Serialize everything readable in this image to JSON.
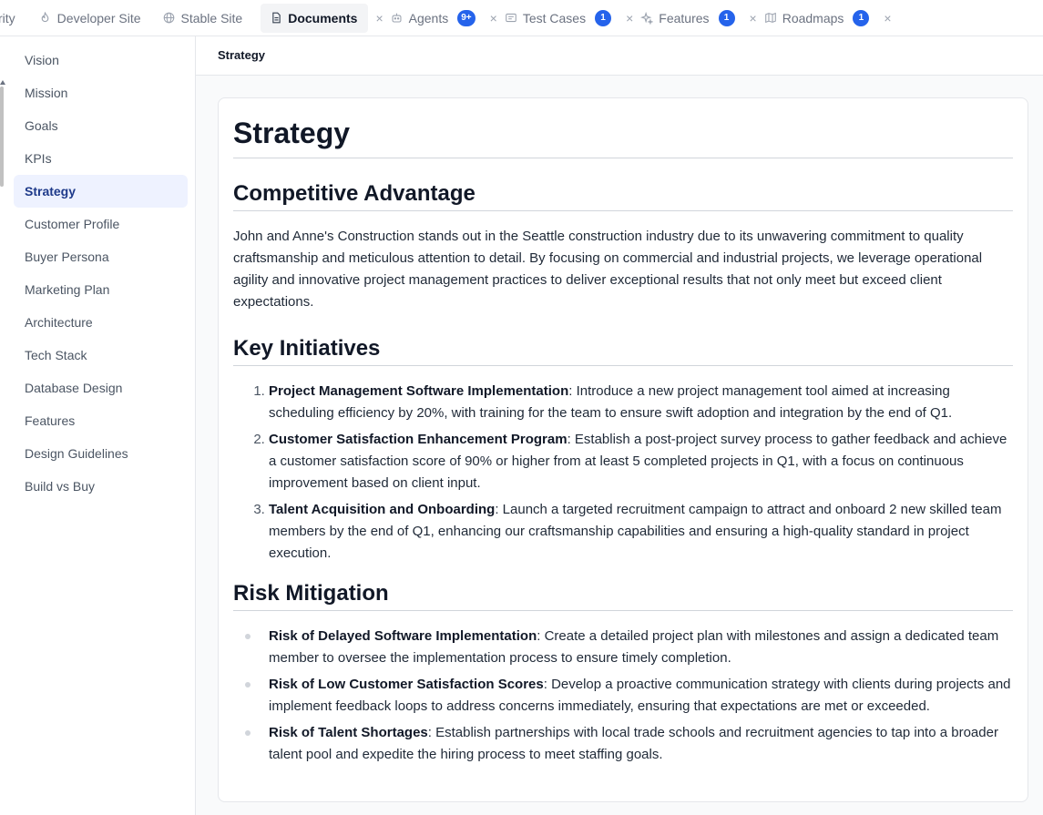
{
  "tabs": [
    {
      "label": "rity",
      "icon": "",
      "close": false,
      "badge": "",
      "truncated": true
    },
    {
      "label": "Developer Site",
      "icon": "flame-icon",
      "close": false,
      "badge": ""
    },
    {
      "label": "Stable Site",
      "icon": "globe-icon",
      "close": false,
      "badge": ""
    },
    {
      "label": "Documents",
      "icon": "document-icon",
      "close": true,
      "badge": "",
      "active": true
    },
    {
      "label": "Agents",
      "icon": "bot-icon",
      "close": true,
      "badge": "9+"
    },
    {
      "label": "Test Cases",
      "icon": "test-icon",
      "close": true,
      "badge": "1"
    },
    {
      "label": "Features",
      "icon": "sparkles-icon",
      "close": true,
      "badge": "1"
    },
    {
      "label": "Roadmaps",
      "icon": "map-icon",
      "close": true,
      "badge": "1"
    }
  ],
  "close_glyph": "×",
  "sidebar": {
    "items": [
      {
        "label": "Vision"
      },
      {
        "label": "Mission"
      },
      {
        "label": "Goals"
      },
      {
        "label": "KPIs"
      },
      {
        "label": "Strategy",
        "active": true
      },
      {
        "label": "Customer Profile"
      },
      {
        "label": "Buyer Persona"
      },
      {
        "label": "Marketing Plan"
      },
      {
        "label": "Architecture"
      },
      {
        "label": "Tech Stack"
      },
      {
        "label": "Database Design"
      },
      {
        "label": "Features"
      },
      {
        "label": "Design Guidelines"
      },
      {
        "label": "Build vs Buy"
      }
    ]
  },
  "header": {
    "breadcrumb": "Strategy"
  },
  "document": {
    "title": "Strategy",
    "competitive": {
      "heading": "Competitive Advantage",
      "text": "John and Anne's Construction stands out in the Seattle construction industry due to its unwavering commitment to quality craftsmanship and meticulous attention to detail. By focusing on commercial and industrial projects, we leverage operational agility and innovative project management practices to deliver exceptional results that not only meet but exceed client expectations."
    },
    "initiatives": {
      "heading": "Key Initiatives",
      "items": [
        {
          "title": "Project Management Software Implementation",
          "text": ": Introduce a new project management tool aimed at increasing scheduling efficiency by 20%, with training for the team to ensure swift adoption and integration by the end of Q1."
        },
        {
          "title": "Customer Satisfaction Enhancement Program",
          "text": ": Establish a post-project survey process to gather feedback and achieve a customer satisfaction score of 90% or higher from at least 5 completed projects in Q1, with a focus on continuous improvement based on client input."
        },
        {
          "title": "Talent Acquisition and Onboarding",
          "text": ": Launch a targeted recruitment campaign to attract and onboard 2 new skilled team members by the end of Q1, enhancing our craftsmanship capabilities and ensuring a high-quality standard in project execution."
        }
      ]
    },
    "risk": {
      "heading": "Risk Mitigation",
      "items": [
        {
          "title": "Risk of Delayed Software Implementation",
          "text": ": Create a detailed project plan with milestones and assign a dedicated team member to oversee the implementation process to ensure timely completion."
        },
        {
          "title": "Risk of Low Customer Satisfaction Scores",
          "text": ": Develop a proactive communication strategy with clients during projects and implement feedback loops to address concerns immediately, ensuring that expectations are met or exceeded."
        },
        {
          "title": "Risk of Talent Shortages",
          "text": ": Establish partnerships with local trade schools and recruitment agencies to tap into a broader talent pool and expedite the hiring process to meet staffing goals."
        }
      ]
    }
  }
}
